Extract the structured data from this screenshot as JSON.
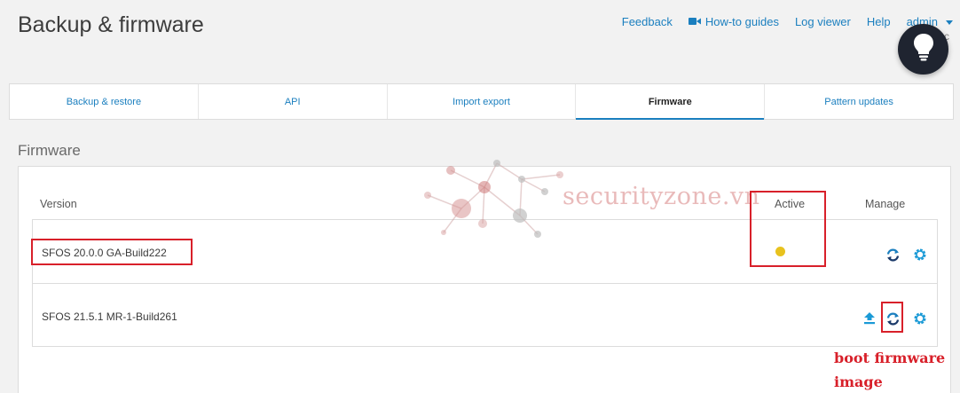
{
  "page": {
    "title": "Backup & firmware"
  },
  "top_nav": {
    "feedback": "Feedback",
    "howto": "How-to guides",
    "log_viewer": "Log viewer",
    "help": "Help",
    "user": "admin",
    "user_suffix": "c"
  },
  "tabs": [
    {
      "label": "Backup & restore",
      "active": false
    },
    {
      "label": "API",
      "active": false
    },
    {
      "label": "Import export",
      "active": false
    },
    {
      "label": "Firmware",
      "active": true
    },
    {
      "label": "Pattern updates",
      "active": false
    }
  ],
  "firmware": {
    "section_title": "Firmware",
    "columns": {
      "version": "Version",
      "active": "Active",
      "manage": "Manage"
    },
    "rows": [
      {
        "version": "SFOS 20.0.0 GA-Build222",
        "active": true
      },
      {
        "version": "SFOS 21.5.1 MR-1-Build261",
        "active": false
      }
    ]
  },
  "annotation": {
    "line1": "boot firmware",
    "line2": "image"
  },
  "watermark": "securityzone.vn",
  "colors": {
    "link": "#1b7fbf",
    "active_dot": "#e8c21e",
    "highlight": "#d8202a",
    "bulb_bg": "#1f2430"
  },
  "icons": {
    "howto": "video-camera-icon",
    "bulb": "lightbulb-icon",
    "boot": "refresh-boot-icon",
    "settings": "gear-icon",
    "upload": "upload-icon"
  }
}
